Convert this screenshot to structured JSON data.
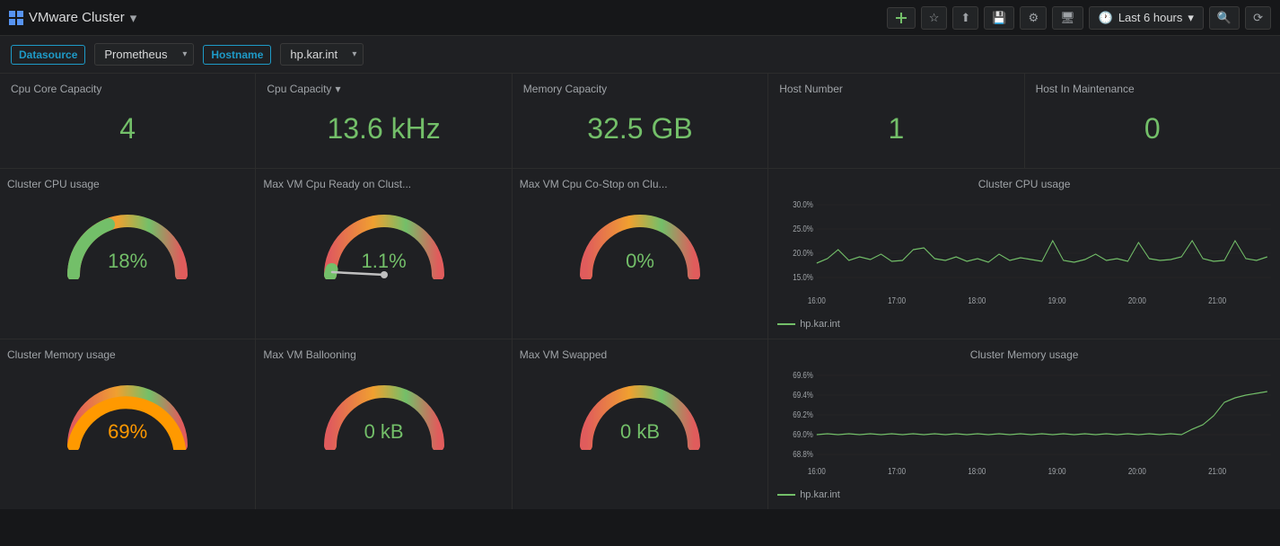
{
  "topbar": {
    "title": "VMware Cluster",
    "chevron": "▾",
    "add_panel_label": "Add panel",
    "star_label": "Star",
    "share_label": "Share",
    "save_label": "Save",
    "settings_label": "Settings",
    "tv_label": "TV Mode",
    "time_label": "Last 6 hours",
    "search_label": "Search",
    "refresh_label": "Refresh"
  },
  "filterbar": {
    "datasource_label": "Datasource",
    "datasource_value": "Prometheus",
    "hostname_label": "Hostname",
    "hostname_value": "hp.kar.int"
  },
  "stats": {
    "cpu_core": {
      "title": "Cpu Core Capacity",
      "value": "4",
      "color": "#73bf69"
    },
    "cpu_cap": {
      "title": "Cpu Capacity",
      "value": "13.6 kHz",
      "color": "#73bf69"
    },
    "mem_cap": {
      "title": "Memory Capacity",
      "value": "32.5 GB",
      "color": "#73bf69"
    },
    "host_num": {
      "title": "Host Number",
      "value": "1",
      "color": "#73bf69"
    },
    "host_maint": {
      "title": "Host In Maintenance",
      "value": "0",
      "color": "#73bf69"
    }
  },
  "gauges": {
    "cluster_cpu": {
      "title": "Cluster CPU usage",
      "value": "18%",
      "value_color": "#73bf69",
      "percent": 18
    },
    "vm_ready": {
      "title": "Max VM Cpu Ready on Clust...",
      "value": "1.1%",
      "value_color": "#73bf69",
      "percent": 1.1
    },
    "vm_costop": {
      "title": "Max VM Cpu Co-Stop on Clu...",
      "value": "0%",
      "value_color": "#73bf69",
      "percent": 0
    },
    "cluster_mem": {
      "title": "Cluster Memory usage",
      "value": "69%",
      "value_color": "#ff9900",
      "percent": 69
    },
    "vm_balloon": {
      "title": "Max VM Ballooning",
      "value": "0 kB",
      "value_color": "#73bf69",
      "percent": 0
    },
    "vm_swapped": {
      "title": "Max VM Swapped",
      "value": "0 kB",
      "value_color": "#73bf69",
      "percent": 0
    }
  },
  "charts": {
    "cpu": {
      "title": "Cluster CPU usage",
      "legend": "hp.kar.int",
      "y_labels": [
        "30.0%",
        "25.0%",
        "20.0%",
        "15.0%"
      ],
      "x_labels": [
        "16:00",
        "17:00",
        "18:00",
        "19:00",
        "20:00",
        "21:00"
      ],
      "color": "#73bf69"
    },
    "mem": {
      "title": "Cluster Memory usage",
      "legend": "hp.kar.int",
      "y_labels": [
        "69.6%",
        "69.4%",
        "69.2%",
        "69.0%",
        "68.8%"
      ],
      "x_labels": [
        "16:00",
        "17:00",
        "18:00",
        "19:00",
        "20:00",
        "21:00"
      ],
      "color": "#73bf69"
    }
  }
}
